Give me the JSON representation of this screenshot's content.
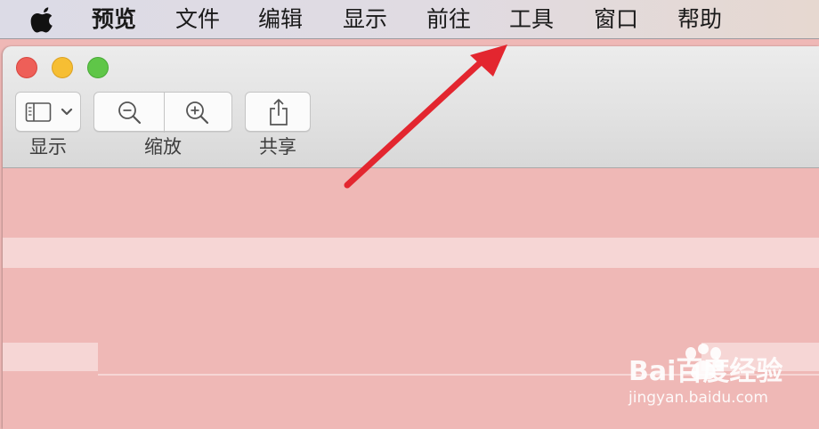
{
  "menubar": {
    "apple_icon": "apple-logo-icon",
    "items": [
      "预览",
      "文件",
      "编辑",
      "显示",
      "前往",
      "工具",
      "窗口",
      "帮助"
    ]
  },
  "window": {
    "traffic_lights": {
      "close_color": "#ee5f58",
      "minimize_color": "#f6be33",
      "zoom_color": "#5fc648"
    },
    "toolbar": {
      "display_label": "显示",
      "zoom_label": "缩放",
      "share_label": "共享",
      "icons": {
        "display": "sidebar-toggle-icon",
        "zoom_out": "zoom-out-icon",
        "zoom_in": "zoom-in-icon",
        "share": "share-icon"
      }
    },
    "content_color": "#efb8b6"
  },
  "annotation": {
    "arrow_color": "#e3262f",
    "points_to": "工具"
  },
  "watermark": {
    "brand": "Bai百度经验",
    "url": "jingyan.baidu.com"
  }
}
